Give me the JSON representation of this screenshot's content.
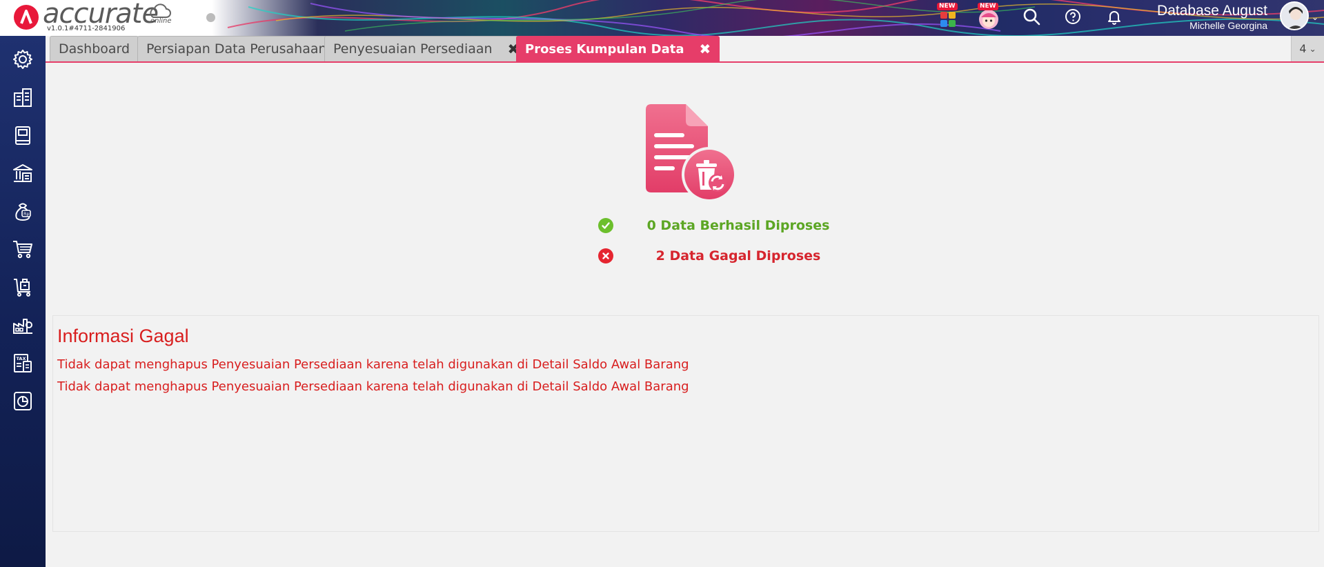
{
  "brand": {
    "name": "accurate",
    "sub": "online",
    "version": "v1.0.1#4711-2841906"
  },
  "header": {
    "new_badge_1": "NEW",
    "new_badge_2": "NEW",
    "database_name": "Database August",
    "user_name": "Michelle Georgina"
  },
  "tabs": [
    {
      "label": "Dashboard",
      "closable": false,
      "active": false
    },
    {
      "label": "Persiapan Data Perusahaan",
      "closable": false,
      "active": false
    },
    {
      "label": "Penyesuaian Persediaan",
      "closable": true,
      "active": false
    },
    {
      "label": "Proses Kumpulan Data",
      "closable": true,
      "active": true
    }
  ],
  "tab_close_glyph": "✖",
  "tab_count": "4",
  "sidebar": {
    "icons": [
      "gear-icon",
      "company-icon",
      "ledger-icon",
      "bank-icon",
      "money-bag-icon",
      "cart-icon",
      "trolley-icon",
      "factory-icon",
      "tax-icon",
      "report-icon"
    ]
  },
  "result": {
    "success_text": "0 Data Berhasil Diproses",
    "failed_text": "2 Data Gagal Diproses"
  },
  "info": {
    "title": "Informasi Gagal",
    "lines": [
      "Tidak dapat menghapus Penyesuaian Persediaan karena telah digunakan di Detail Saldo Awal Barang",
      "Tidak dapat menghapus Penyesuaian Persediaan karena telah digunakan di Detail Saldo Awal Barang"
    ]
  },
  "colors": {
    "accent": "#e63d69",
    "sidebar": "#132257",
    "success": "#5ca624",
    "error": "#d6252e"
  }
}
